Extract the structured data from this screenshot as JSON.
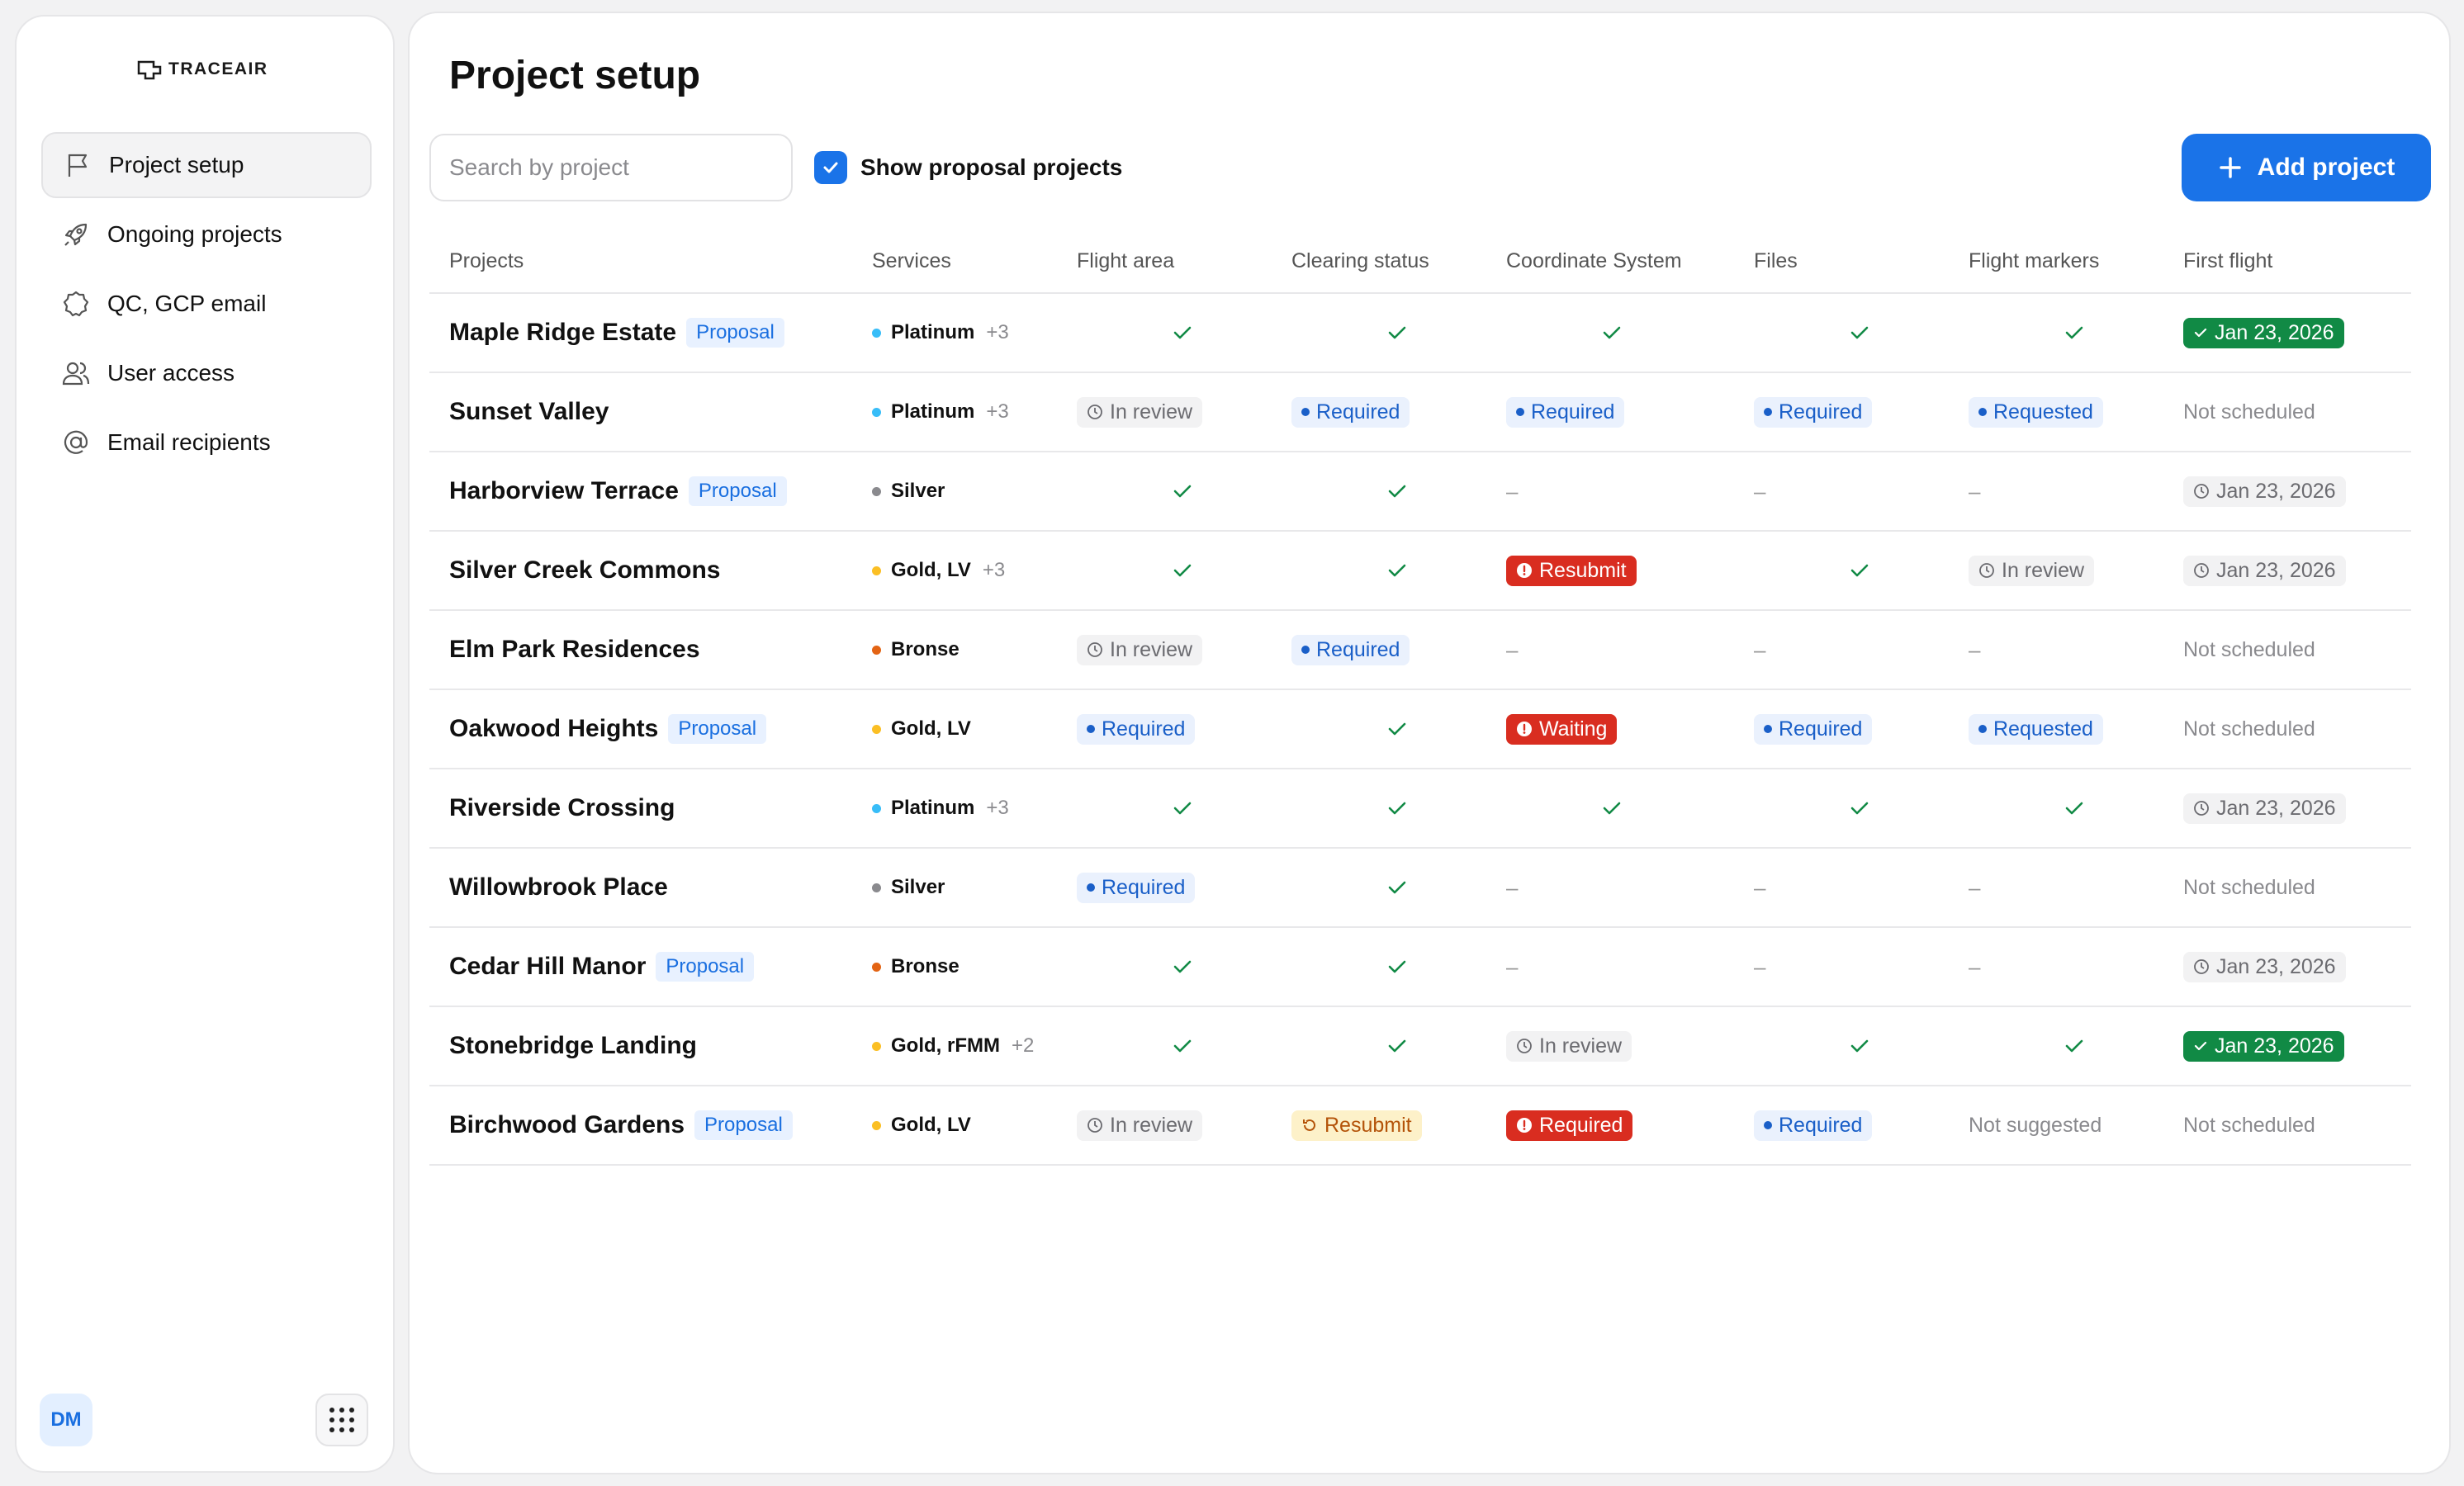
{
  "app": {
    "logo": "TRACEAIR"
  },
  "sidebar": {
    "items": [
      {
        "label": "Project setup",
        "icon": "flag-icon"
      },
      {
        "label": "Ongoing projects",
        "icon": "rocket-icon"
      },
      {
        "label": "QC, GCP email",
        "icon": "badge-icon"
      },
      {
        "label": "User access",
        "icon": "users-icon"
      },
      {
        "label": "Email recipients",
        "icon": "at-icon"
      }
    ],
    "avatar": "DM"
  },
  "header": {
    "title": "Project setup",
    "search_placeholder": "Search by project",
    "show_proposal_label": "Show proposal projects",
    "add_project_label": "Add project"
  },
  "table": {
    "columns": [
      "Projects",
      "Services",
      "Flight area",
      "Clearing status",
      "Coordinate System",
      "Files",
      "Flight markers",
      "First flight"
    ],
    "proposal_label": "Proposal",
    "rows": [
      {
        "name": "Maple Ridge Estate",
        "proposal": true,
        "services": "Platinum",
        "service_color": "#38bdf8",
        "more": "+3",
        "cells": [
          {
            "t": "check"
          },
          {
            "t": "check"
          },
          {
            "t": "check"
          },
          {
            "t": "check"
          },
          {
            "t": "check"
          }
        ],
        "first": {
          "t": "green",
          "v": "Jan 23, 2026"
        }
      },
      {
        "name": "Sunset Valley",
        "proposal": false,
        "services": "Platinum",
        "service_color": "#38bdf8",
        "more": "+3",
        "cells": [
          {
            "t": "review",
            "v": "In review"
          },
          {
            "t": "blue",
            "v": "Required"
          },
          {
            "t": "blue",
            "v": "Required"
          },
          {
            "t": "blue",
            "v": "Required"
          },
          {
            "t": "blue",
            "v": "Requested"
          }
        ],
        "first": {
          "t": "muted",
          "v": "Not scheduled"
        }
      },
      {
        "name": "Harborview Terrace",
        "proposal": true,
        "services": "Silver",
        "service_color": "#8a8a8e",
        "more": "",
        "cells": [
          {
            "t": "check"
          },
          {
            "t": "check"
          },
          {
            "t": "dash",
            "v": "–"
          },
          {
            "t": "dash",
            "v": "–"
          },
          {
            "t": "dash",
            "v": "–"
          }
        ],
        "first": {
          "t": "review",
          "v": "Jan 23, 2026"
        }
      },
      {
        "name": "Silver Creek Commons",
        "proposal": false,
        "services": "Gold,  LV",
        "service_color": "#fbbf24",
        "more": "+3",
        "cells": [
          {
            "t": "check"
          },
          {
            "t": "check"
          },
          {
            "t": "red",
            "v": "Resubmit"
          },
          {
            "t": "check"
          },
          {
            "t": "review",
            "v": "In review"
          }
        ],
        "first": {
          "t": "review",
          "v": "Jan 23, 2026"
        }
      },
      {
        "name": "Elm Park Residences",
        "proposal": false,
        "services": "Bronse",
        "service_color": "#e36414",
        "more": "",
        "cells": [
          {
            "t": "review",
            "v": "In review"
          },
          {
            "t": "blue",
            "v": "Required"
          },
          {
            "t": "dash",
            "v": "–"
          },
          {
            "t": "dash",
            "v": "–"
          },
          {
            "t": "dash",
            "v": "–"
          }
        ],
        "first": {
          "t": "muted",
          "v": "Not scheduled"
        }
      },
      {
        "name": "Oakwood Heights",
        "proposal": true,
        "services": "Gold,  LV",
        "service_color": "#fbbf24",
        "more": "",
        "cells": [
          {
            "t": "blue",
            "v": "Required"
          },
          {
            "t": "check"
          },
          {
            "t": "red",
            "v": "Waiting"
          },
          {
            "t": "blue",
            "v": "Required"
          },
          {
            "t": "blue",
            "v": "Requested"
          }
        ],
        "first": {
          "t": "muted",
          "v": "Not scheduled"
        }
      },
      {
        "name": "Riverside Crossing",
        "proposal": false,
        "services": "Platinum",
        "service_color": "#38bdf8",
        "more": "+3",
        "cells": [
          {
            "t": "check"
          },
          {
            "t": "check"
          },
          {
            "t": "check"
          },
          {
            "t": "check"
          },
          {
            "t": "check"
          }
        ],
        "first": {
          "t": "review",
          "v": "Jan 23, 2026"
        }
      },
      {
        "name": "Willowbrook Place",
        "proposal": false,
        "services": "Silver",
        "service_color": "#8a8a8e",
        "more": "",
        "cells": [
          {
            "t": "blue",
            "v": "Required"
          },
          {
            "t": "check"
          },
          {
            "t": "dash",
            "v": "–"
          },
          {
            "t": "dash",
            "v": "–"
          },
          {
            "t": "dash",
            "v": "–"
          }
        ],
        "first": {
          "t": "muted",
          "v": "Not scheduled"
        }
      },
      {
        "name": "Cedar Hill Manor",
        "proposal": true,
        "services": "Bronse",
        "service_color": "#e36414",
        "more": "",
        "cells": [
          {
            "t": "check"
          },
          {
            "t": "check"
          },
          {
            "t": "dash",
            "v": "–"
          },
          {
            "t": "dash",
            "v": "–"
          },
          {
            "t": "dash",
            "v": "–"
          }
        ],
        "first": {
          "t": "review",
          "v": "Jan 23, 2026"
        }
      },
      {
        "name": "Stonebridge Landing",
        "proposal": false,
        "services": "Gold,  rFMM",
        "service_color": "#fbbf24",
        "more": "+2",
        "cells": [
          {
            "t": "check"
          },
          {
            "t": "check"
          },
          {
            "t": "review",
            "v": "In review"
          },
          {
            "t": "check"
          },
          {
            "t": "check"
          }
        ],
        "first": {
          "t": "green",
          "v": "Jan 23, 2026"
        }
      },
      {
        "name": "Birchwood Gardens",
        "proposal": true,
        "services": "Gold,  LV",
        "service_color": "#fbbf24",
        "more": "",
        "cells": [
          {
            "t": "review",
            "v": "In review"
          },
          {
            "t": "yellow",
            "v": "Resubmit"
          },
          {
            "t": "red",
            "v": "Required"
          },
          {
            "t": "blue",
            "v": "Required"
          },
          {
            "t": "muted",
            "v": "Not suggested"
          }
        ],
        "first": {
          "t": "muted",
          "v": "Not scheduled"
        }
      }
    ]
  },
  "colors": {
    "accent": "#1a73e8",
    "check": "#118a45",
    "danger": "#d92d20"
  }
}
